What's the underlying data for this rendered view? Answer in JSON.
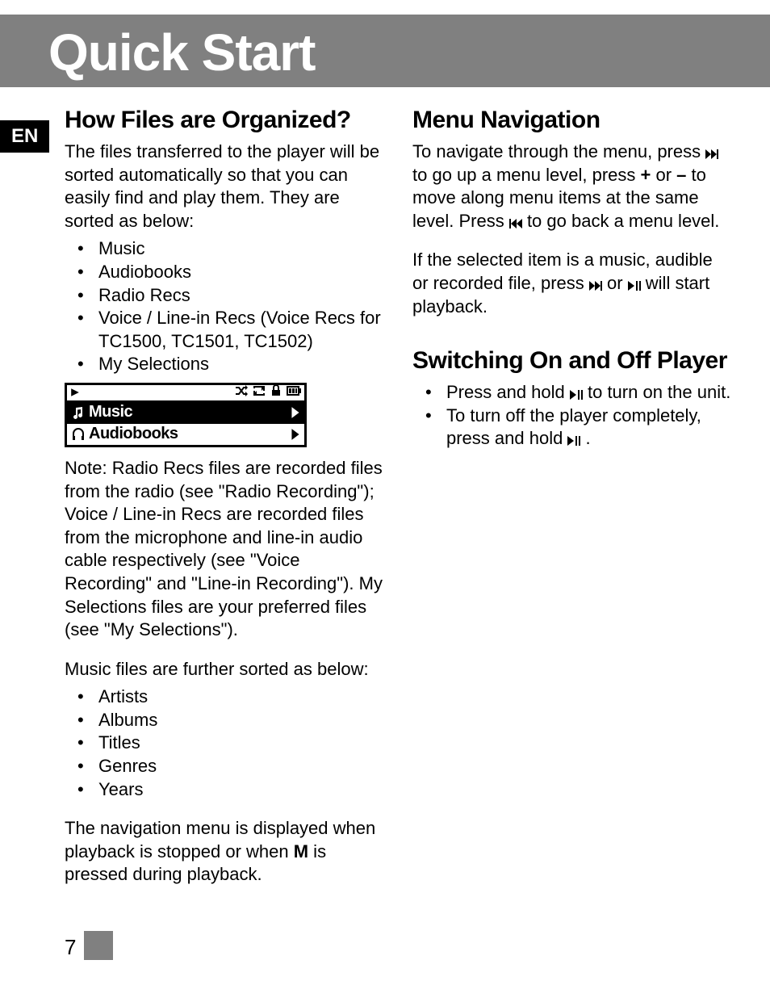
{
  "title": "Quick Start",
  "lang_badge": "EN",
  "left": {
    "heading": "How Files are Organized?",
    "intro": "The files transferred to the player will be sorted automatically so that you can easily find and play them. They are sorted as below:",
    "categories": [
      "Music",
      "Audiobooks",
      "Radio Recs",
      "Voice / Line-in Recs (Voice Recs for TC1500, TC1501, TC1502)",
      "My Selections"
    ],
    "lcd": {
      "row1": "Music",
      "row2": "Audiobooks"
    },
    "note": "Note: Radio Recs files are recorded files from the radio (see \"Radio Recording\"); Voice / Line-in Recs are recorded files from the microphone and line-in audio cable respectively (see \"Voice Recording\" and \"Line-in Recording\"). My Selections files are your preferred files (see \"My Selections\").",
    "music_intro": "Music files are further sorted as below:",
    "music_sort": [
      "Artists",
      "Albums",
      "Titles",
      "Genres",
      "Years"
    ],
    "nav_text_pre": "The navigation menu is displayed when playback is stopped or when ",
    "nav_text_m": "M",
    "nav_text_post": " is pressed during playback."
  },
  "right": {
    "nav_heading": "Menu Navigation",
    "nav_p1_a": "To navigate through the menu, press ",
    "nav_p1_b": " to go up a menu level, press ",
    "nav_p1_plus": "+",
    "nav_p1_or": " or ",
    "nav_p1_minus": "–",
    "nav_p1_c": " to move along menu items at the same level. Press ",
    "nav_p1_d": " to go back a menu level.",
    "nav_p2_a": "If the selected item is a music, audible or recorded file, press ",
    "nav_p2_or": " or ",
    "nav_p2_b": " will start playback.",
    "switch_heading": "Switching On and Off Player",
    "switch_b1_a": "Press and hold ",
    "switch_b1_b": " to turn on the unit.",
    "switch_b2_a": "To turn off the player completely, press and hold ",
    "switch_b2_b": " ."
  },
  "page_number": "7"
}
